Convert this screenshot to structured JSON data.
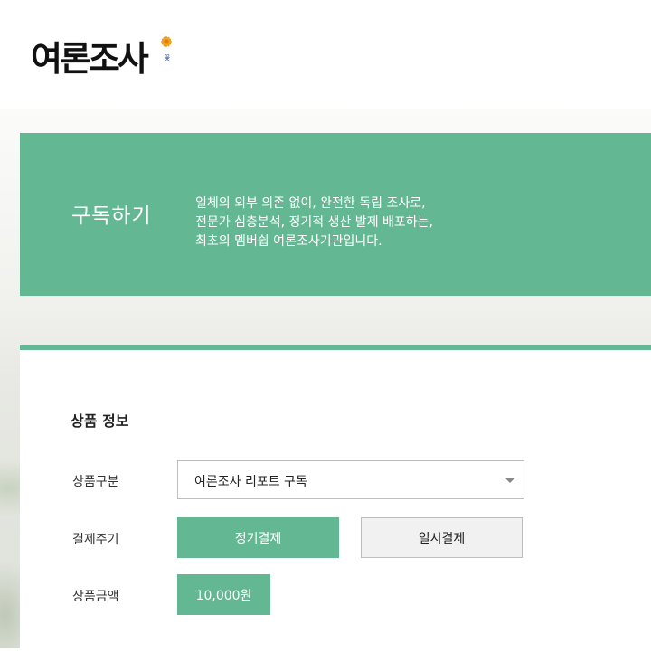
{
  "logo": {
    "text": "여론조사",
    "sub": "꽃"
  },
  "hero": {
    "title": "구독하기",
    "description": [
      "일체의 외부 의존 없이, 완전한 독립 조사로,",
      "전문가 심층분석, 정기적 생산 발제 배포하는,",
      "최초의 멤버쉽 여론조사기관입니다."
    ]
  },
  "product_info": {
    "section_title": "상품 정보",
    "type_label": "상품구분",
    "type_value": "여론조사 리포트 구독",
    "cycle_label": "결제주기",
    "cycle_options": [
      "정기결제",
      "일시결제"
    ],
    "selected_cycle": "정기결제",
    "price_label": "상품금액",
    "price_value": "10,000원"
  },
  "colors": {
    "accent": "#63b893"
  }
}
